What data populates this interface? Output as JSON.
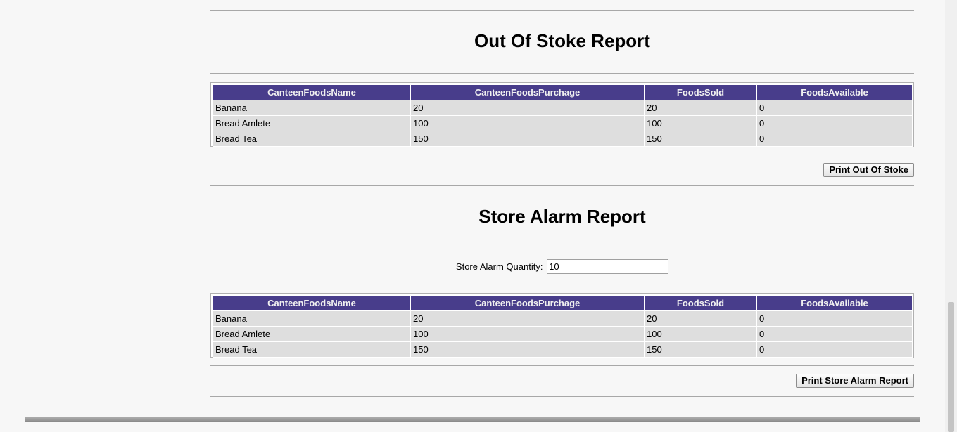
{
  "out_of_stock": {
    "title": "Out Of Stoke Report",
    "columns": [
      "CanteenFoodsName",
      "CanteenFoodsPurchage",
      "FoodsSold",
      "FoodsAvailable"
    ],
    "rows": [
      [
        "Banana",
        "20",
        "20",
        "0"
      ],
      [
        "Bread Amlete",
        "100",
        "100",
        "0"
      ],
      [
        "Bread Tea",
        "150",
        "150",
        "0"
      ]
    ],
    "print_button": "Print Out Of Stoke"
  },
  "store_alarm": {
    "title": "Store Alarm Report",
    "quantity_label": "Store Alarm Quantity:",
    "quantity_value": "10",
    "columns": [
      "CanteenFoodsName",
      "CanteenFoodsPurchage",
      "FoodsSold",
      "FoodsAvailable"
    ],
    "rows": [
      [
        "Banana",
        "20",
        "20",
        "0"
      ],
      [
        "Bread Amlete",
        "100",
        "100",
        "0"
      ],
      [
        "Bread Tea",
        "150",
        "150",
        "0"
      ]
    ],
    "print_button": "Print Store Alarm Report"
  }
}
